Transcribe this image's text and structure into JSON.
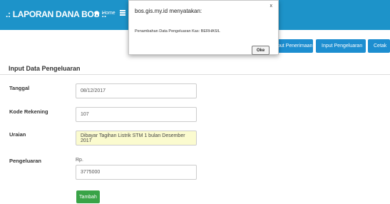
{
  "navbar": {
    "brand": ".: LAPORAN DANA BOS :.",
    "home_label": "Home"
  },
  "actions": {
    "penerimaan_label": "put Penerimaan",
    "pengeluaran_label": "Input Pengeluaran",
    "cetak_label": "Cetak"
  },
  "page": {
    "title": "Input Data Pengeluaran"
  },
  "form": {
    "tanggal_label": "Tanggal",
    "tanggal_value": "08/12/2017",
    "rekening_label": "Kode Rekening",
    "rekening_value": "107",
    "uraian_label": "Uraian",
    "uraian_value": "Dibayar Tagihan Listrik STM 1 bulan Desember 2017",
    "pengeluaran_label": "Pengeluaran",
    "currency_prefix": "Rp.",
    "pengeluaran_value": "3775000",
    "submit_label": "Tambah"
  },
  "dialog": {
    "title": "bos.gis.my.id menyatakan:",
    "close": "x",
    "message": "Penambahan Data Pengeluaran Kas: BERHASIL",
    "ok_label": "Oke"
  },
  "colors": {
    "navbar": "#1d93c9",
    "button_blue": "#1d8ed0",
    "button_green": "#39a347",
    "field_highlight": "#fbfbcf"
  }
}
